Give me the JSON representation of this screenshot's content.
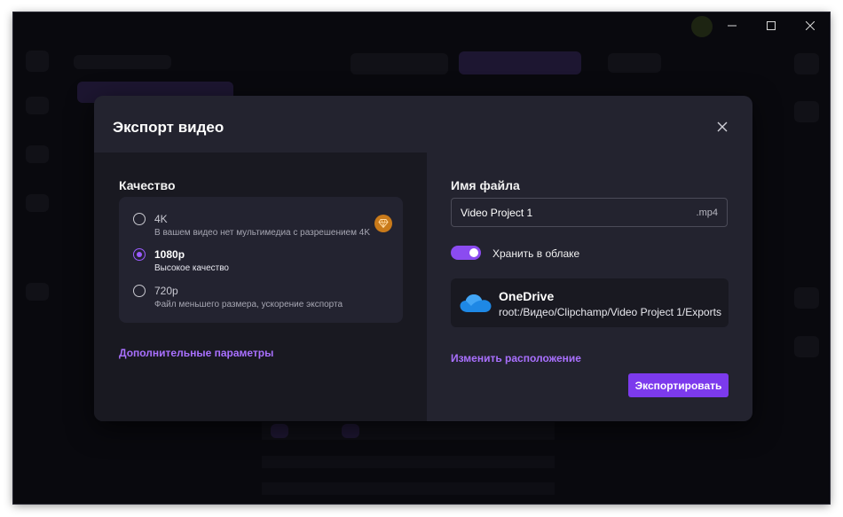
{
  "dialog": {
    "title": "Экспорт видео"
  },
  "quality": {
    "heading": "Качество",
    "options": [
      {
        "title": "4K",
        "description": "В вашем видео нет мультимедиа с разрешением 4K",
        "selected": false,
        "premium": true
      },
      {
        "title": "1080p",
        "description": "Высокое качество",
        "selected": true,
        "premium": false
      },
      {
        "title": "720p",
        "description": "Файл меньшего размера, ускорение экспорта",
        "selected": false,
        "premium": false
      }
    ],
    "advanced_link": "Дополнительные параметры"
  },
  "filename": {
    "heading": "Имя файла",
    "value": "Video Project 1",
    "extension": ".mp4"
  },
  "cloud": {
    "toggle_label": "Хранить в облаке",
    "enabled": true,
    "provider": "OneDrive",
    "path": "root:/Видео/Clipchamp/Video Project 1/Exports",
    "change_location_link": "Изменить расположение"
  },
  "actions": {
    "export_label": "Экспортировать"
  },
  "colors": {
    "accent": "#7c3aed",
    "link": "#a970ff",
    "premium_badge": "#c97a1a",
    "onedrive": "#1e88e5"
  },
  "icons": {
    "close": "close-icon",
    "premium": "diamond-icon",
    "onedrive": "onedrive-cloud-icon"
  }
}
